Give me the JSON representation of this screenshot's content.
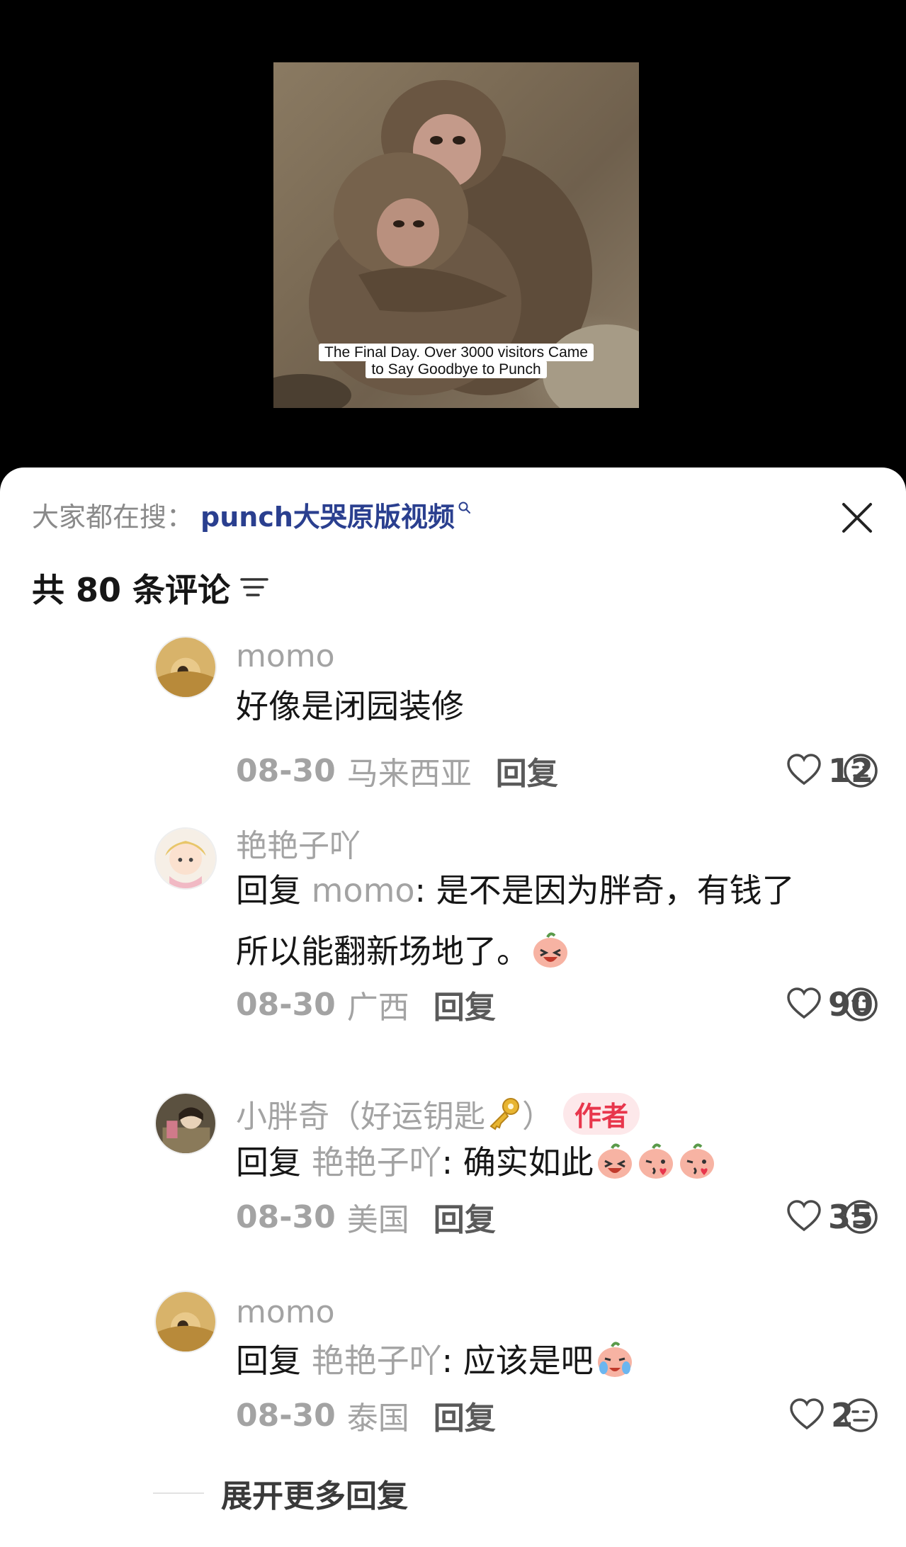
{
  "video": {
    "caption_line1": "The Final Day. Over 3000 visitors Came",
    "caption_line2": "to Say Goodbye to Punch"
  },
  "sheet": {
    "search_prefix": "大家都在搜：",
    "search_term": "punch大哭原版视频",
    "comment_count_label": "共 80 条评论"
  },
  "comments": [
    {
      "username": "momo",
      "text": "好像是闭园装修",
      "date": "08-30",
      "location": "马来西亚",
      "reply_label": "回复",
      "likes": "12"
    },
    {
      "username": "艳艳子吖",
      "reply_prefix": "回复",
      "reply_to": "momo",
      "text_line1": ": 是不是因为胖奇，有钱了",
      "text_line2": "所以能翻新场地了。",
      "date": "08-30",
      "location": "广西",
      "reply_label": "回复",
      "likes": "90"
    },
    {
      "username": "小胖奇（好运钥匙",
      "username_suffix": "）",
      "author_badge": "作者",
      "reply_prefix": "回复",
      "reply_to": "艳艳子吖",
      "text": ": 确实如此",
      "date": "08-30",
      "location": "美国",
      "reply_label": "回复",
      "likes": "35"
    },
    {
      "username": "momo",
      "reply_prefix": "回复",
      "reply_to": "艳艳子吖",
      "text": ": 应该是吧",
      "date": "08-30",
      "location": "泰国",
      "reply_label": "回复",
      "likes": "2"
    }
  ],
  "expand_label": "展开更多回复",
  "icons": {
    "close": "close-icon",
    "sort": "sort-icon",
    "like": "heart-icon",
    "dislike": "face-icon",
    "search": "search-icon",
    "key": "key-icon"
  },
  "colors": {
    "sheet_bg": "#ffffff",
    "video_bg": "#000000",
    "search_term": "#2a3f8f",
    "author_badge_bg": "#fde8ea",
    "author_badge_text": "#e8364c",
    "muted_text": "#a3a3a3"
  }
}
